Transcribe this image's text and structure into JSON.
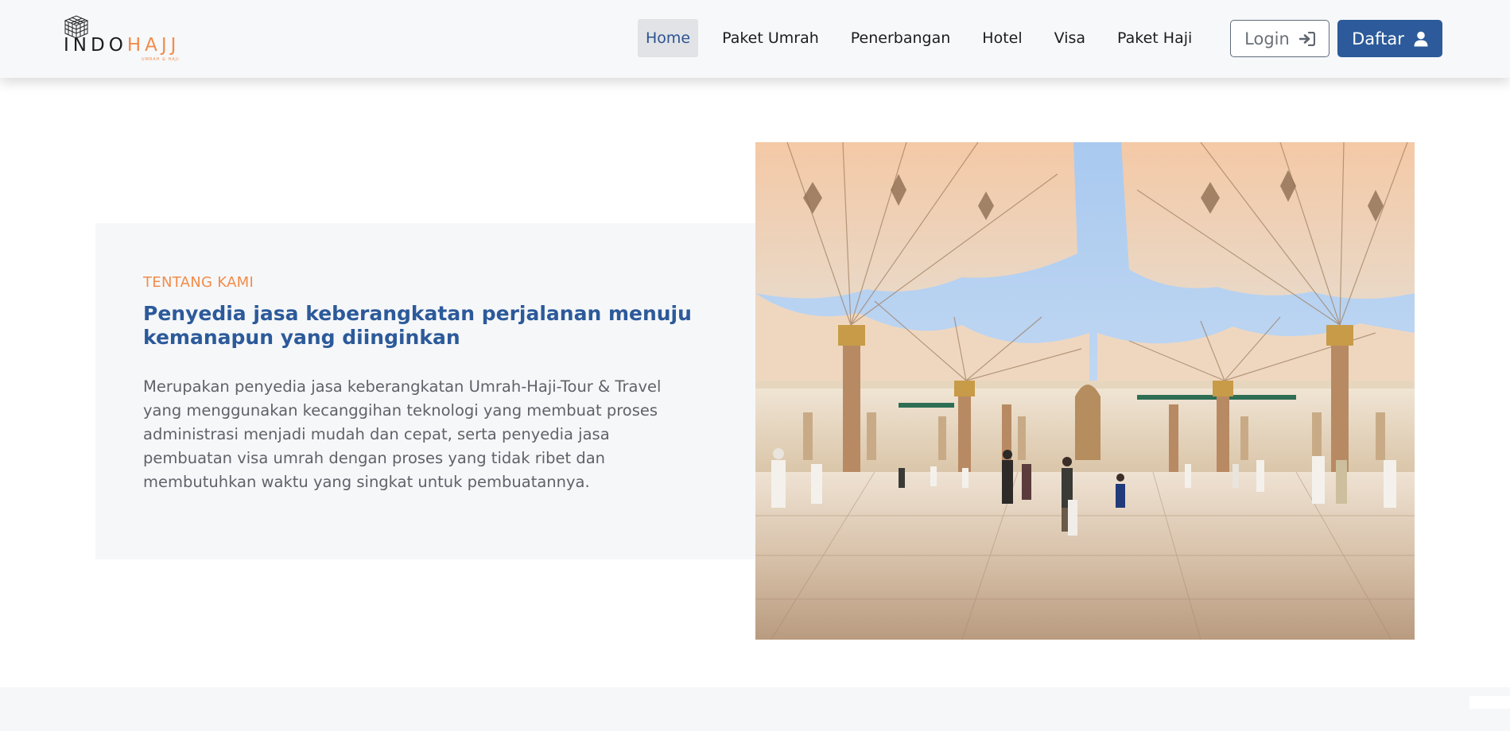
{
  "brand": {
    "word_dark": "INDO",
    "word_accent": "HAJJ",
    "tagline": "UMRAH & HAJI",
    "accent_color": "#f28c4a",
    "primary_color": "#2c5a9a"
  },
  "nav": {
    "items": [
      {
        "label": "Home",
        "active": true
      },
      {
        "label": "Paket Umrah",
        "active": false
      },
      {
        "label": "Penerbangan",
        "active": false
      },
      {
        "label": "Hotel",
        "active": false
      },
      {
        "label": "Visa",
        "active": false
      },
      {
        "label": "Paket Haji",
        "active": false
      }
    ],
    "login_label": "Login",
    "login_icon": "sign-in-icon",
    "register_label": "Daftar",
    "register_icon": "user-icon"
  },
  "about": {
    "eyebrow": "TENTANG KAMI",
    "title": "Penyedia jasa keberangkatan perjalanan menuju kemanapun yang diinginkan",
    "body": "Merupakan penyedia jasa keberangkatan Umrah-Haji-Tour & Travel yang menggunakan kecanggihan teknologi yang membuat proses administrasi menjadi mudah dan cepat, serta penyedia jasa pembuatan visa umrah dengan proses yang tidak ribet dan membutuhkan waktu yang singkat untuk pembuatannya."
  }
}
